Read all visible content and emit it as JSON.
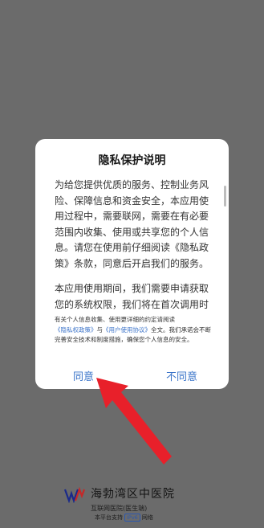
{
  "dialog": {
    "title": "隐私保护说明",
    "paragraph1": "为给您提供优质的服务、控制业务风险、保障信息和资金安全，本应用使用过程中，需要联网，需要在有必要范围内收集、使用或共享您的个人信息。请您在使用前仔细阅读《隐私政策》条款，同意后开启我们的服务。",
    "paragraph2": "本应用使用期间，我们需要申请获取您的系统权限，我们将在首次调用时逐项",
    "notice_prefix": "有关个人信息收集、使用更详细的约定请阅读",
    "privacy_link": "《隐私权政策》",
    "notice_and": "与",
    "agreement_link": "《用户使用协议》",
    "notice_suffix": "全文。我们承诺会不断完善安全技术和制度措施，确保您个人信息的安全。",
    "agree_label": "同意",
    "disagree_label": "不同意"
  },
  "footer": {
    "hospital_name": "海勃湾区中医院",
    "subtitle": "互联网医院(医生端)",
    "platform_prefix": "本平台支持",
    "platform_badge": "IPv6",
    "platform_suffix": "网络"
  },
  "colors": {
    "overlay": "#6b6b6b",
    "link": "#3b73c9",
    "arrow": "#e8202a"
  }
}
